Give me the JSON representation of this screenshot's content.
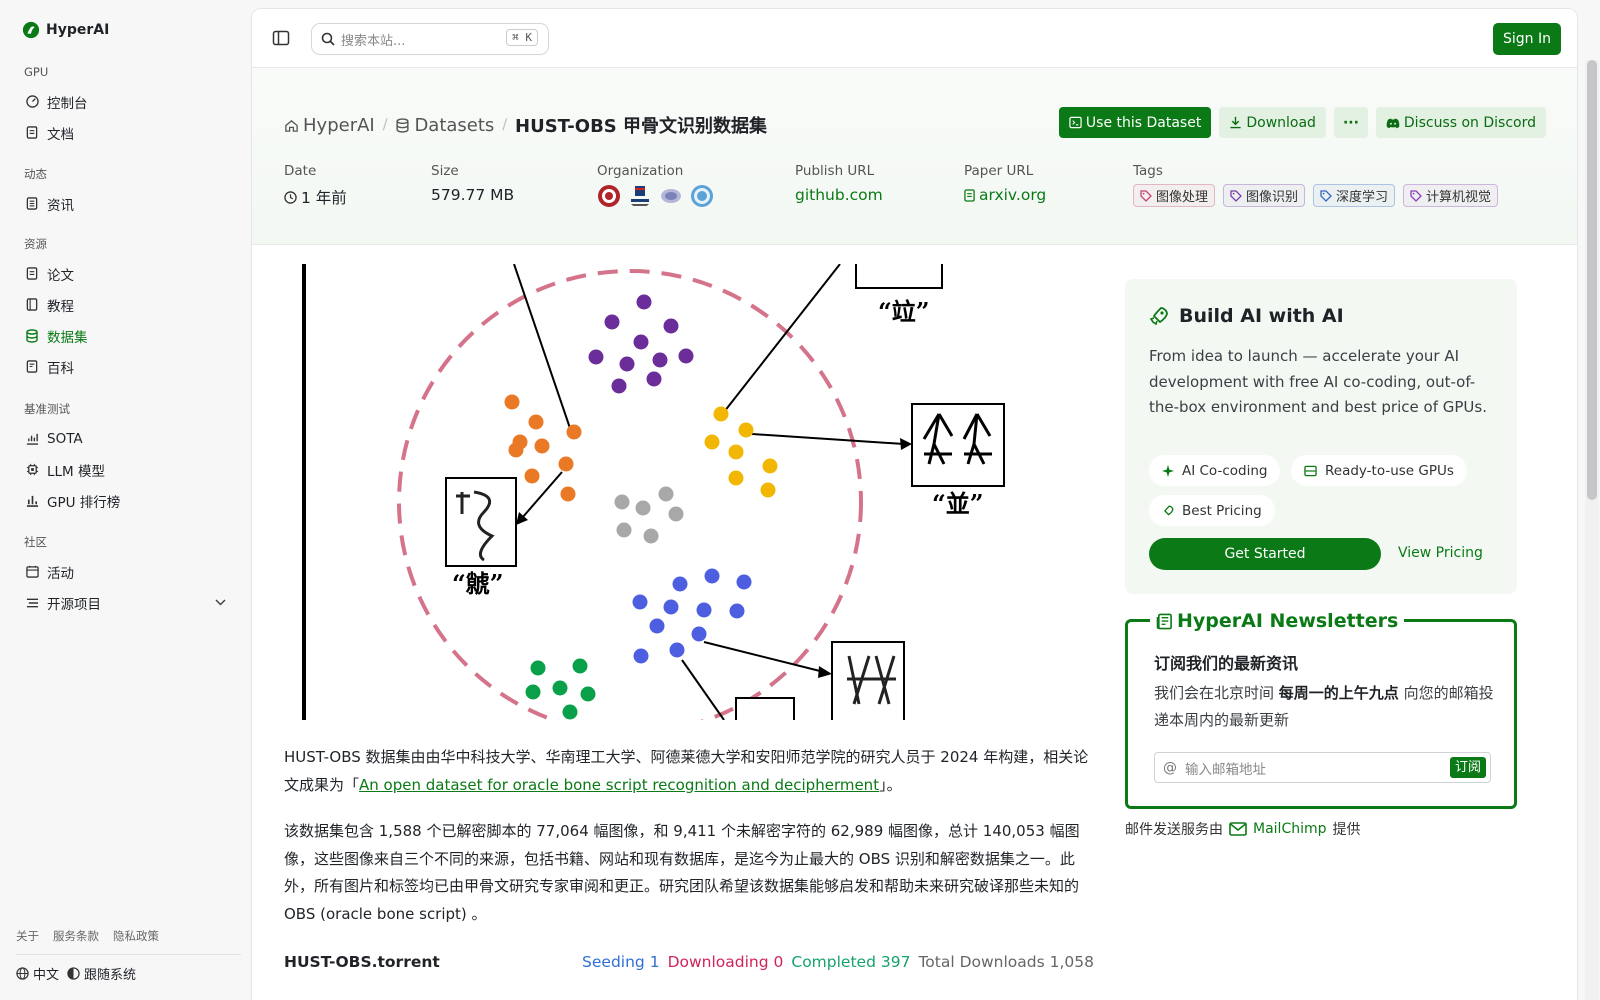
{
  "brand": {
    "name": "HyperAI"
  },
  "sidebar": {
    "groups": [
      {
        "title": "GPU",
        "items": [
          {
            "label": "控制台",
            "icon": "gauge-icon"
          },
          {
            "label": "文档",
            "icon": "doc-icon"
          }
        ]
      },
      {
        "title": "动态",
        "items": [
          {
            "label": "资讯",
            "icon": "news-icon"
          }
        ]
      },
      {
        "title": "资源",
        "items": [
          {
            "label": "论文",
            "icon": "paper-icon"
          },
          {
            "label": "教程",
            "icon": "book-icon"
          },
          {
            "label": "数据集",
            "icon": "database-icon",
            "active": true
          },
          {
            "label": "百科",
            "icon": "wiki-icon"
          }
        ]
      },
      {
        "title": "基准测试",
        "items": [
          {
            "label": "SOTA",
            "icon": "chart-icon"
          },
          {
            "label": "LLM 模型",
            "icon": "chip-icon"
          },
          {
            "label": "GPU 排行榜",
            "icon": "bar-chart-icon"
          }
        ]
      },
      {
        "title": "社区",
        "items": [
          {
            "label": "活动",
            "icon": "calendar-icon"
          },
          {
            "label": "开源项目",
            "icon": "list-icon"
          }
        ]
      }
    ],
    "footer_links": [
      "关于",
      "服务条款",
      "隐私政策"
    ],
    "language": "中文",
    "theme": "跟随系统"
  },
  "topbar": {
    "search_placeholder": "搜索本站...",
    "search_shortcut": "K",
    "signin": "Sign In"
  },
  "breadcrumb": {
    "home": "HyperAI",
    "section": "Datasets",
    "current": "HUST-OBS 甲骨文识别数据集"
  },
  "actions": {
    "use": "Use this Dataset",
    "download": "Download",
    "more": "···",
    "discord": "Discuss on Discord"
  },
  "meta": {
    "date_label": "Date",
    "date_value": "1 年前",
    "size_label": "Size",
    "size_value": "579.77 MB",
    "org_label": "Organization",
    "publish_label": "Publish URL",
    "publish_value": "github.com",
    "paper_label": "Paper URL",
    "paper_value": "arxiv.org",
    "tags_label": "Tags",
    "tags": [
      {
        "label": "图像处理",
        "color": "#c0447a"
      },
      {
        "label": "图像识别",
        "color": "#7a3fb0"
      },
      {
        "label": "深度学习",
        "color": "#3465c4"
      },
      {
        "label": "计算机视觉",
        "color": "#8a3fb8"
      }
    ]
  },
  "figure": {
    "labels": [
      "“竝”",
      "“並”",
      "“虩”"
    ]
  },
  "content": {
    "p1_before": "HUST-OBS 数据集由由华中科技大学、华南理工大学、阿德莱德大学和安阳师范学院的研究人员于 2024 年构建，相关论文成果为「",
    "p1_link": "An open dataset for oracle bone script recognition and decipherment",
    "p1_after": "」。",
    "p2": "该数据集包含 1,588 个已解密脚本的 77,064 幅图像，和 9,411 个未解密字符的 62,989 幅图像，总计 140,053 幅图像，这些图像来自三个不同的来源，包括书籍、网站和现有数据库，是迄今为止最大的 OBS 识别和解密数据集之一。此外，所有图片和标签均已由甲骨文研究专家审阅和更正。研究团队希望该数据集能够启发和帮助未来研究破译那些未知的 OBS (oracle bone script) 。",
    "torrent_name": "HUST-OBS.torrent",
    "seeding": "Seeding 1",
    "downloading": "Downloading 0",
    "completed": "Completed 397",
    "total": "Total Downloads 1,058"
  },
  "build": {
    "title": "Build AI with AI",
    "desc": "From idea to launch — accelerate your AI development with free AI co-coding, out-of-the-box environment and best price of GPUs.",
    "pills": [
      "AI Co-coding",
      "Ready-to-use GPUs",
      "Best Pricing"
    ],
    "cta": "Get Started",
    "pricing": "View Pricing"
  },
  "newsletter": {
    "title": "HyperAI Newsletters",
    "heading": "订阅我们的最新资讯",
    "desc_a": "我们会在北京时间 ",
    "desc_bold": "每周一的上午九点",
    "desc_b": " 向您的邮箱投递本周内的最新更新",
    "placeholder": "输入邮箱地址",
    "subscribe": "订阅",
    "provider_a": "邮件发送服务由",
    "provider": "MailChimp",
    "provider_b": "提供"
  },
  "colors": {
    "accent": "#0b7a16",
    "seeding": "#2f6fd6",
    "downloading": "#d0245a",
    "completed": "#16a36a"
  }
}
